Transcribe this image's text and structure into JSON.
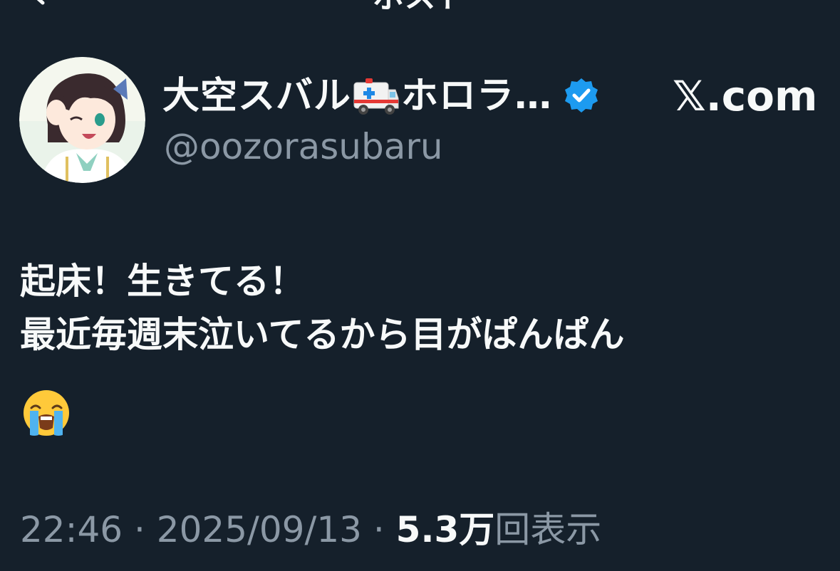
{
  "header": {
    "title": "ポスト"
  },
  "author": {
    "display_name_part1": "大空スバル",
    "display_name_part2": "ホロラ…",
    "handle": "@oozorasubaru",
    "verified": true
  },
  "site_label": "𝕏.com",
  "post": {
    "line1": "起床！生きてる！",
    "line2": "最近毎週末泣いてるから目がぱんぱん",
    "emoji": "loudly-crying-face-icon"
  },
  "meta": {
    "time": "22:46",
    "separator": " · ",
    "date": "2025/09/13",
    "views_count": "5.3万",
    "views_label": "回表示"
  },
  "colors": {
    "background": "#15202b",
    "primary_text": "#f7f9f9",
    "secondary_text": "#8b98a5",
    "verified_blue": "#1d9bf0"
  }
}
